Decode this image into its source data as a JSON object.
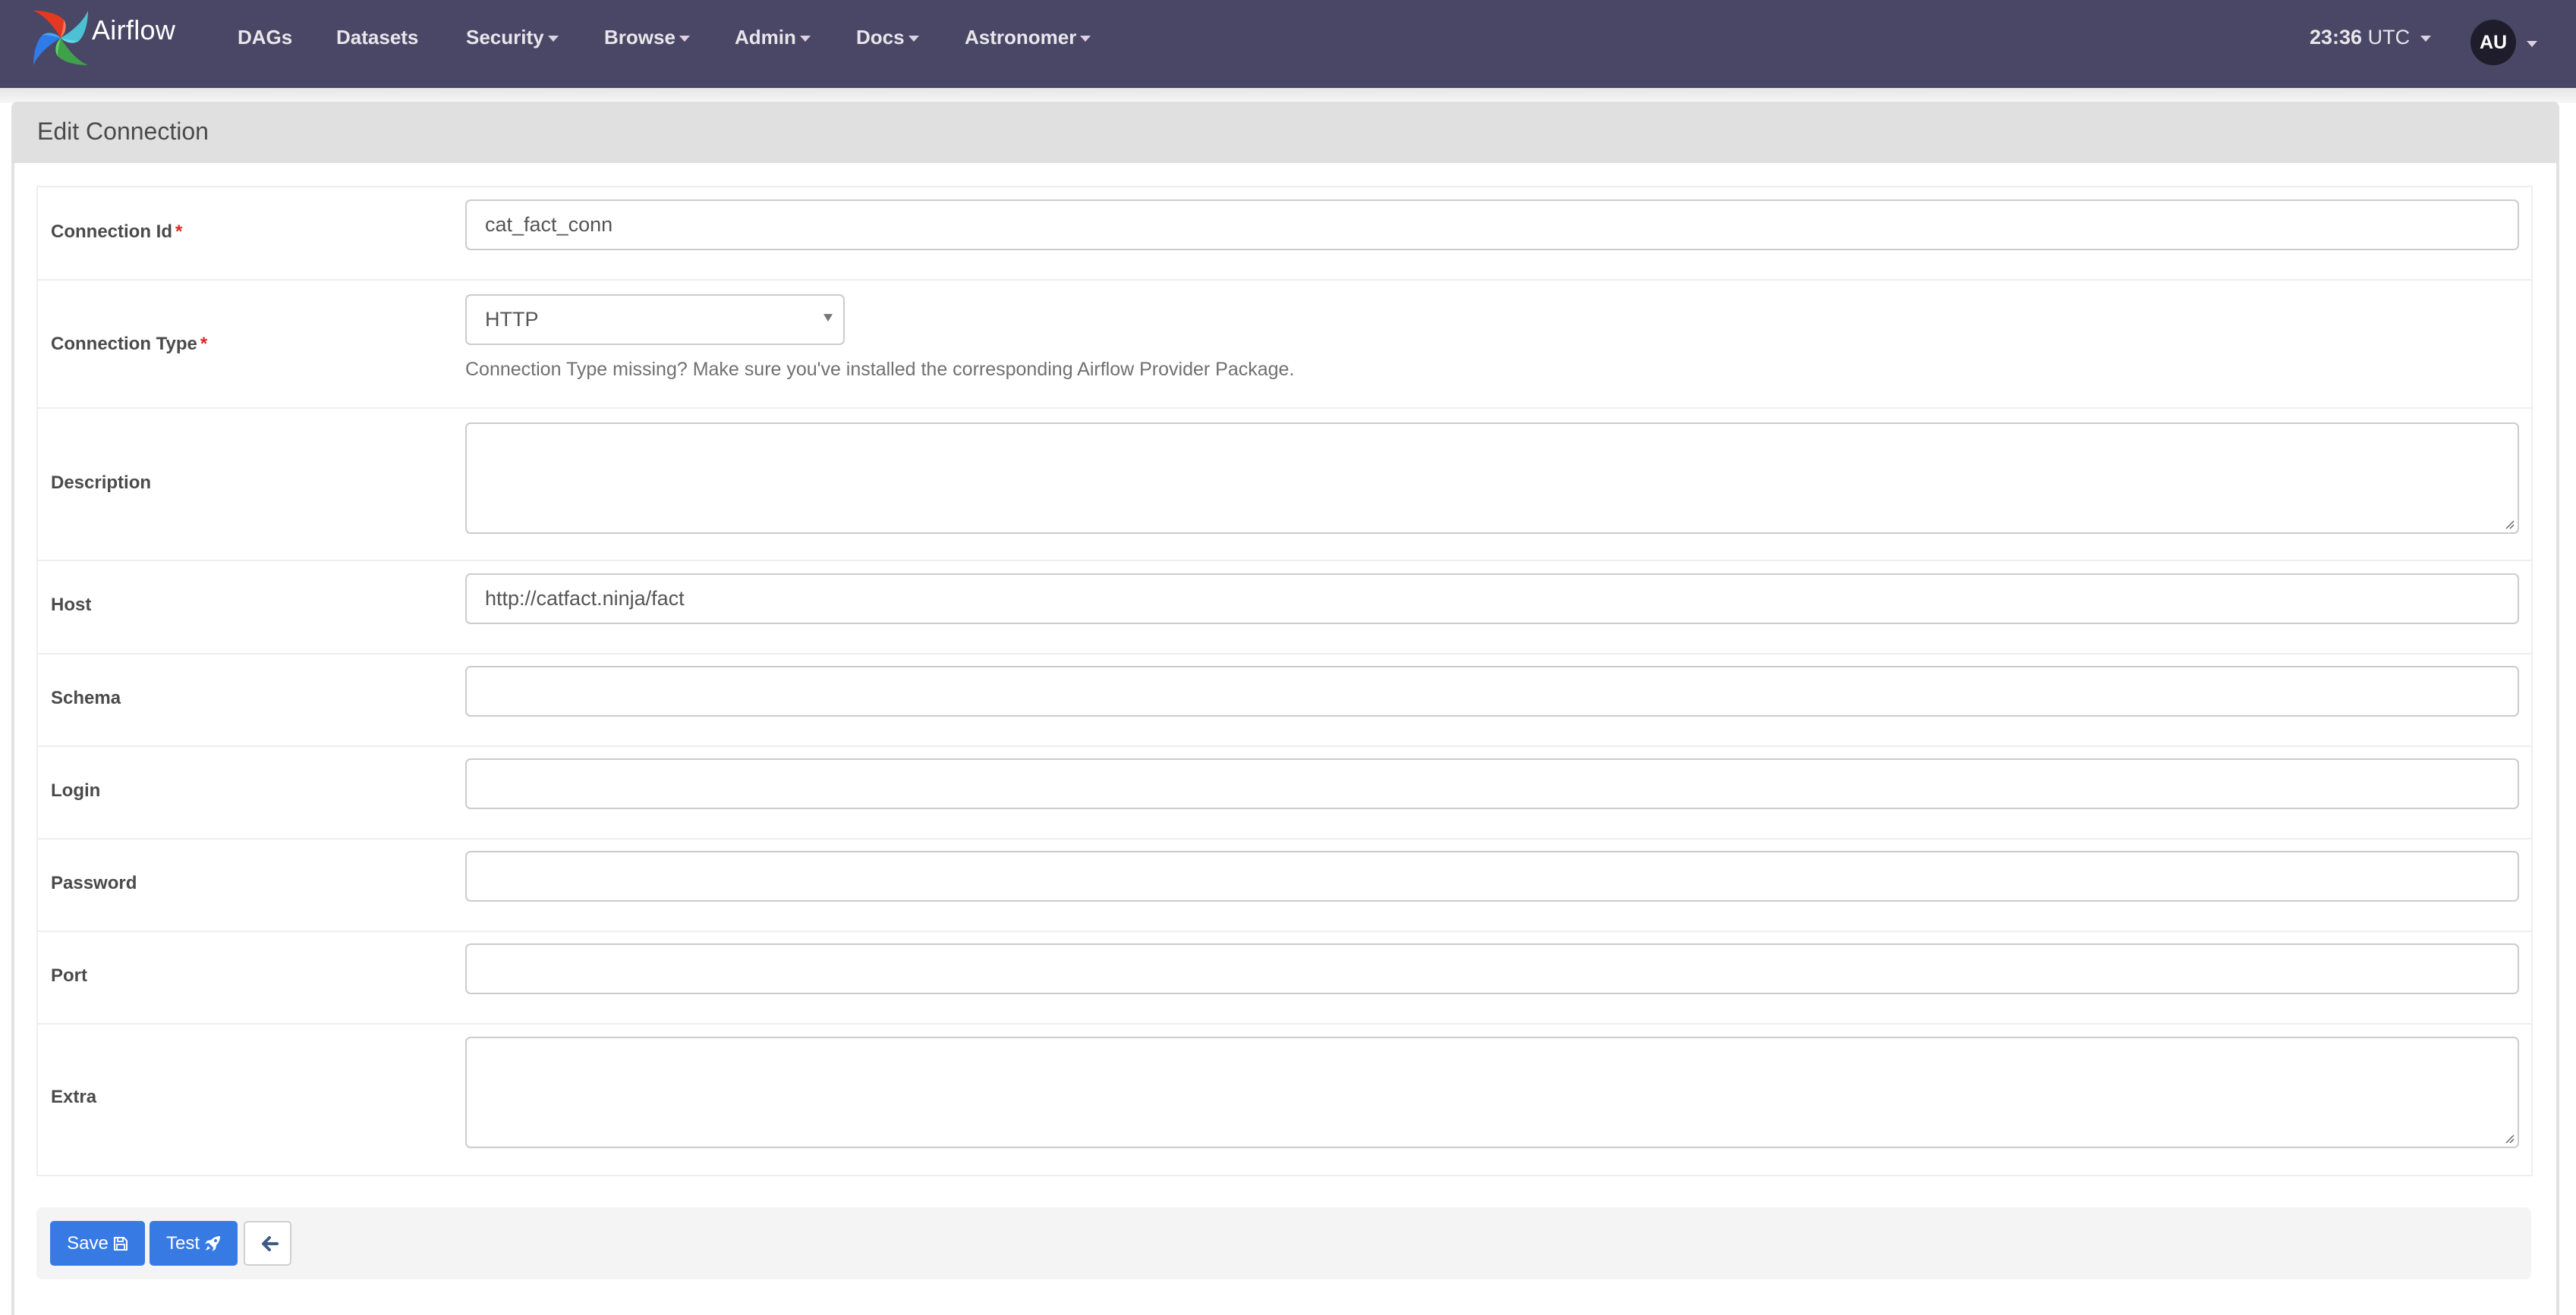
{
  "navbar": {
    "brand": "Airflow",
    "items": [
      {
        "label": "DAGs",
        "dropdown": false
      },
      {
        "label": "Datasets",
        "dropdown": false
      },
      {
        "label": "Security",
        "dropdown": true
      },
      {
        "label": "Browse",
        "dropdown": true
      },
      {
        "label": "Admin",
        "dropdown": true
      },
      {
        "label": "Docs",
        "dropdown": true
      },
      {
        "label": "Astronomer",
        "dropdown": true
      }
    ],
    "time": {
      "clock": "23:36",
      "zone": "UTC"
    },
    "user_initials": "AU",
    "colors": {
      "background": "#4a4665",
      "avatar": "#1f1d2b"
    }
  },
  "panel": {
    "title": "Edit Connection"
  },
  "form": {
    "required_marker": "*",
    "fields": {
      "conn_id": {
        "label": "Connection Id",
        "required": true,
        "value": ""
      },
      "conn_type": {
        "label": "Connection Type",
        "required": true,
        "selected": "HTTP",
        "help": "Connection Type missing? Make sure you've installed the corresponding Airflow Provider Package."
      },
      "description": {
        "label": "Description",
        "value": ""
      },
      "host": {
        "label": "Host",
        "value": "http://catfact.ninja/fact"
      },
      "schema": {
        "label": "Schema",
        "value": ""
      },
      "login": {
        "label": "Login",
        "value": ""
      },
      "password": {
        "label": "Password",
        "value": ""
      },
      "port": {
        "label": "Port",
        "value": ""
      },
      "extra": {
        "label": "Extra",
        "value": ""
      }
    },
    "conn_id_value": "cat_fact_conn"
  },
  "actions": {
    "save": {
      "label": "Save",
      "icon": "floppy-disk-icon"
    },
    "test": {
      "label": "Test",
      "icon": "rocket-icon"
    },
    "back": {
      "icon": "arrow-left-icon"
    },
    "primary_color": "#387ae4"
  }
}
